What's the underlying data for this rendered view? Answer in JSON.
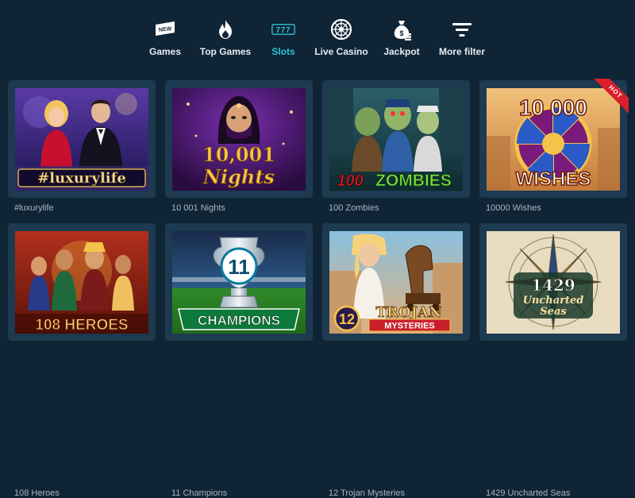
{
  "nav": {
    "items": [
      {
        "label": "Games",
        "icon": "new-badge-icon"
      },
      {
        "label": "Top Games",
        "icon": "flame-icon"
      },
      {
        "label": "Slots",
        "icon": "777-slots-icon",
        "active": true
      },
      {
        "label": "Live Casino",
        "icon": "roulette-wheel-icon"
      },
      {
        "label": "Jackpot",
        "icon": "money-bag-icon"
      },
      {
        "label": "More filter",
        "icon": "filter-funnel-icon"
      }
    ],
    "new_badge_text": "NEW",
    "slots_icon_text": "777"
  },
  "games": [
    {
      "title": "#luxurylife",
      "thumb_title": "#luxurylife"
    },
    {
      "title": "10 001 Nights",
      "thumb_title_top": "10,001",
      "thumb_title_bottom": "Nights"
    },
    {
      "title": "100 Zombies",
      "thumb_title_num": "100",
      "thumb_title_word": "ZOMBIES"
    },
    {
      "title": "10000 Wishes",
      "thumb_title_top": "10 000",
      "thumb_title_bottom": "WISHES",
      "badge": "HOT"
    },
    {
      "title": "108 Heroes",
      "thumb_title": "108 HEROES"
    },
    {
      "title": "11 Champions",
      "thumb_title_num": "11",
      "thumb_title_word": "CHAMPIONS"
    },
    {
      "title": "12 Trojan Mysteries",
      "thumb_title_num": "12",
      "thumb_title_top": "TROJAN",
      "thumb_title_bottom": "MYSTERIES"
    },
    {
      "title": "1429 Uncharted Seas",
      "thumb_title_num": "1429",
      "thumb_title_top": "Uncharted",
      "thumb_title_bottom": "Seas"
    }
  ],
  "colors": {
    "background": "#0f2435",
    "card": "#1d3a50",
    "accent": "#2ec4d6",
    "hot_badge": "#d81f2a"
  }
}
